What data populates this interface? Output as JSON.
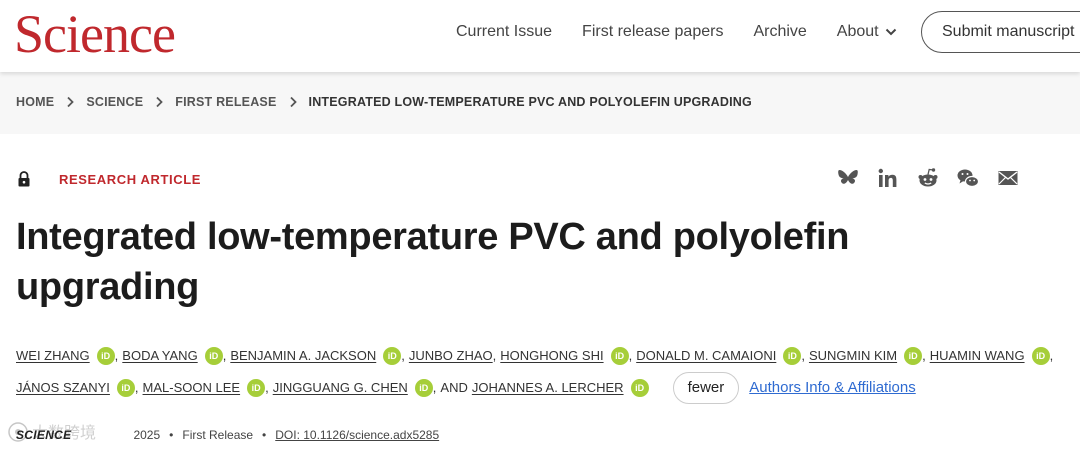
{
  "header": {
    "logo": "Science",
    "nav": [
      "Current Issue",
      "First release papers",
      "Archive",
      "About"
    ],
    "submit_label": "Submit manuscript"
  },
  "breadcrumb": [
    "HOME",
    "SCIENCE",
    "FIRST RELEASE",
    "INTEGRATED LOW-TEMPERATURE PVC AND POLYOLEFIN UPGRADING"
  ],
  "article": {
    "type": "RESEARCH ARTICLE",
    "title_line1": "Integrated low-temperature PVC and polyolefin",
    "title_line2": "upgrading",
    "authors_row1": [
      {
        "name": "WEI ZHANG",
        "orcid": true
      },
      {
        "name": "BODA YANG",
        "orcid": true
      },
      {
        "name": "BENJAMIN A. JACKSON",
        "orcid": true
      },
      {
        "name": "JUNBO ZHAO",
        "orcid": false
      },
      {
        "name": "HONGHONG SHI",
        "orcid": true
      },
      {
        "name": "DONALD M. CAMAIONI",
        "orcid": true
      },
      {
        "name": "SUNGMIN KIM",
        "orcid": true
      },
      {
        "name": "HUAMIN WANG",
        "orcid": true
      }
    ],
    "authors_row2": [
      {
        "name": "JÁNOS SZANYI",
        "orcid": true
      },
      {
        "name": "MAL-SOON LEE",
        "orcid": true
      },
      {
        "name": "JINGGUANG G. CHEN",
        "orcid": true
      },
      {
        "name": "JOHANNES A. LERCHER",
        "orcid": true
      }
    ],
    "orcid_label": "iD",
    "and_text": "AND",
    "fewer_label": "fewer",
    "affiliations_label": "Authors Info & Affiliations",
    "journal": "SCIENCE",
    "date_fragment": "2025",
    "release": "First Release",
    "doi": "DOI: 10.1126/science.adx5285",
    "watermark": "大数跨境"
  },
  "share_icons": [
    "bluesky-icon",
    "linkedin-icon",
    "reddit-icon",
    "wechat-icon",
    "email-icon"
  ],
  "colors": {
    "brand": "#c0282d",
    "orcid": "#a6ce39",
    "link": "#2f6bd1"
  }
}
